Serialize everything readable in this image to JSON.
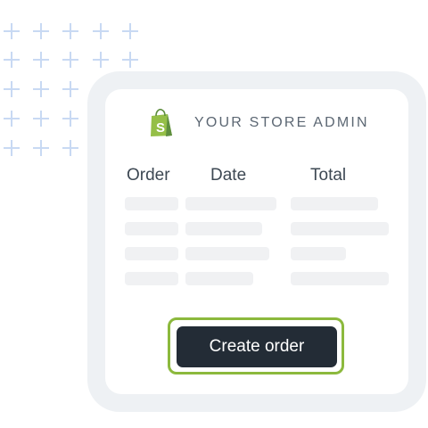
{
  "store": {
    "title": "YOUR STORE ADMIN",
    "logo_icon": "shopify-bag-icon"
  },
  "table": {
    "columns": [
      "Order",
      "Date",
      "Total"
    ],
    "rows_count_placeholder": 4
  },
  "actions": {
    "create_order_label": "Create order"
  },
  "colors": {
    "accent_ring": "#8cb93d",
    "button_bg": "#232c36",
    "logo_green": "#95bf47",
    "frame_bg": "#eef1f4"
  }
}
